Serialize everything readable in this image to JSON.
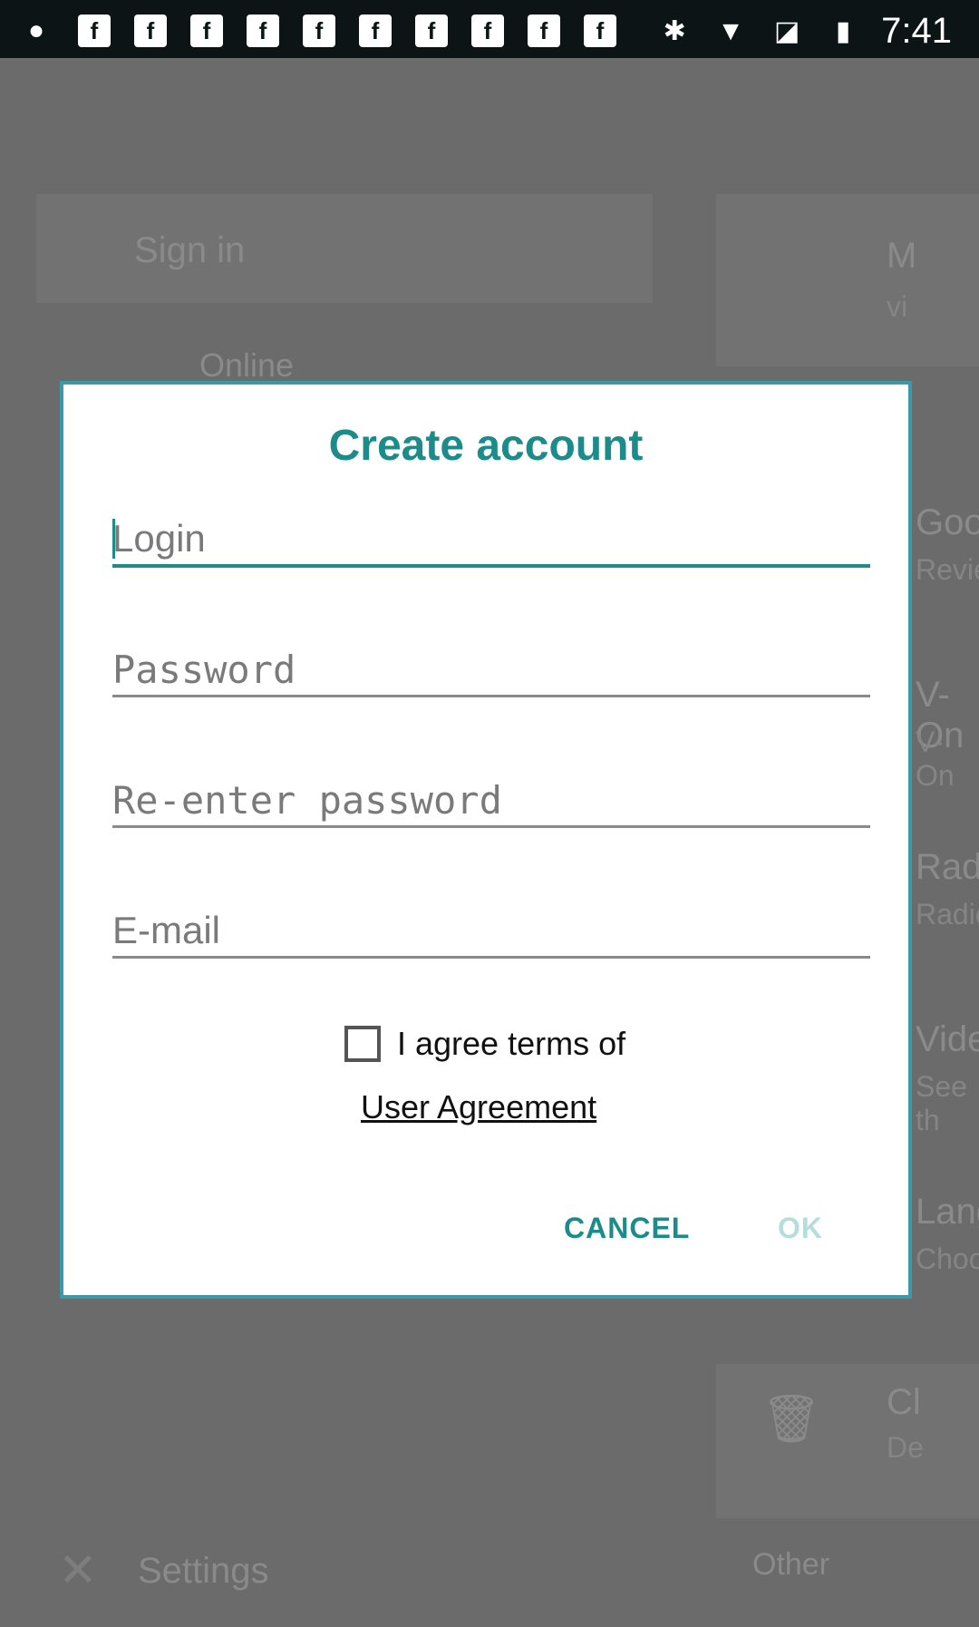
{
  "status_bar": {
    "notifications": [
      "f",
      "f",
      "f",
      "f",
      "f",
      "f",
      "f",
      "f",
      "f",
      "f"
    ],
    "left_icon": "android-icon",
    "icons": [
      "bluetooth-icon",
      "wifi-icon",
      "no-sim-icon",
      "battery-charging-icon"
    ],
    "time": "7:41"
  },
  "background": {
    "sign_in": "Sign in",
    "online": "Online",
    "items": [
      {
        "title": "M",
        "subtitle": "vi"
      },
      {
        "title": "Goog",
        "subtitle": "Revie"
      },
      {
        "title": "V-On",
        "subtitle": "V-On"
      },
      {
        "title": "Radio",
        "subtitle": "Radio"
      },
      {
        "title": "Video",
        "subtitle": "See th"
      },
      {
        "title": "Langu",
        "subtitle": "Choos"
      },
      {
        "title": "Cl",
        "subtitle": "De"
      }
    ],
    "other": "Other",
    "settings": "Settings"
  },
  "dialog": {
    "title": "Create account",
    "login_placeholder": "Login",
    "password_placeholder": "Password",
    "reenter_placeholder": "Re-enter password",
    "email_placeholder": "E-mail",
    "agree_text": "I agree terms of",
    "user_agreement": "User Agreement",
    "cancel": "CANCEL",
    "ok": "OK"
  },
  "colors": {
    "accent": "#1c8c8a",
    "ok_disabled": "#b7dcdc",
    "modal_border": "#3b9aa8",
    "scrim": "#6b6b6b"
  }
}
